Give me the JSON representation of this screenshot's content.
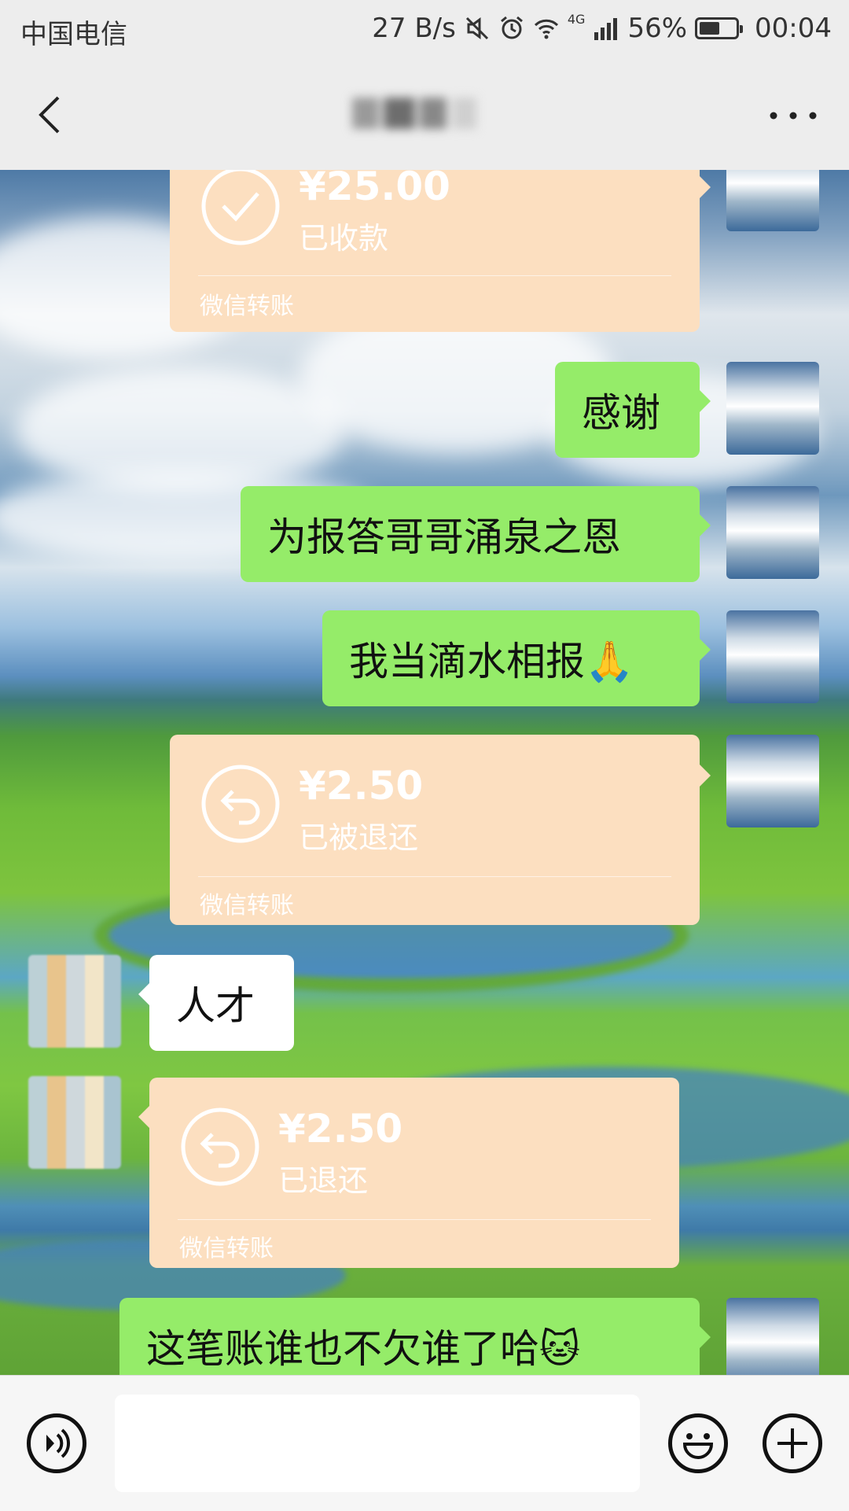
{
  "status_bar": {
    "carrier": "中国电信",
    "net_speed": "27 B/s",
    "signal_tag": "4G",
    "battery_percent": "56%",
    "battery_level": 0.56,
    "time": "00:04",
    "icons": [
      "mute-icon",
      "alarm-icon",
      "wifi-icon",
      "signal-icon",
      "battery-icon"
    ]
  },
  "nav": {
    "back_icon": "back-arrow-icon",
    "more_icon": "more-dots-icon"
  },
  "messages": [
    {
      "type": "transfer",
      "side": "right",
      "amount": "¥25.00",
      "status": "已收款",
      "icon": "check-circle-icon",
      "footer": "微信转账"
    },
    {
      "type": "text",
      "side": "right",
      "text": "感谢"
    },
    {
      "type": "text",
      "side": "right",
      "text": "为报答哥哥涌泉之恩"
    },
    {
      "type": "text",
      "side": "right",
      "text": "我当滴水相报🙏"
    },
    {
      "type": "transfer",
      "side": "right",
      "amount": "¥2.50",
      "status": "已被退还",
      "icon": "return-arrow-icon",
      "footer": "微信转账"
    },
    {
      "type": "text",
      "side": "left",
      "text": "人才"
    },
    {
      "type": "transfer",
      "side": "left",
      "amount": "¥2.50",
      "status": "已退还",
      "icon": "return-arrow-icon",
      "footer": "微信转账"
    },
    {
      "type": "text",
      "side": "right",
      "text": "这笔账谁也不欠谁了哈🐱"
    }
  ],
  "input_bar": {
    "voice_icon": "voice-icon",
    "emoji_icon": "emoji-icon",
    "plus_icon": "plus-icon"
  },
  "colors": {
    "green_bubble": "#95ec69",
    "transfer_bubble": "#fcdfc0",
    "header_bg": "#ededed"
  }
}
